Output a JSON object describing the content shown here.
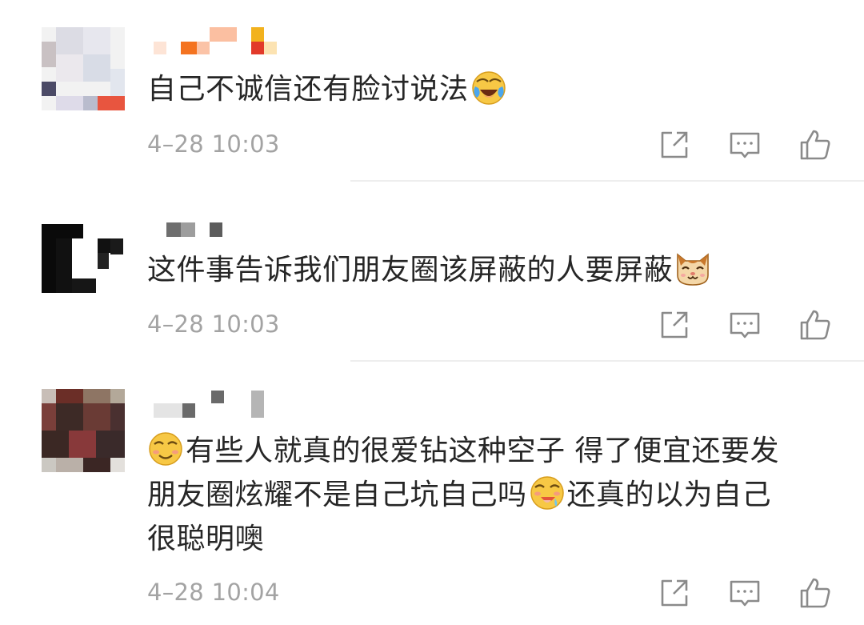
{
  "comments": [
    {
      "text": "自己不诚信还有脸讨说法",
      "emoji": "crying-laughing-emoji",
      "time": "4–28 10:03"
    },
    {
      "text": "这件事告诉我们朋友圈该屏蔽的人要屏蔽",
      "emoji": "cat-face-emoji",
      "time": "4–28 10:03"
    },
    {
      "text_prefix_emoji": "smirk-emoji",
      "text_line1": "有些人就真的很爱钻这种空子 得了便宜还要发",
      "text_line2_a": "朋友圈炫耀不是自己坑自己吗",
      "emoji_mid": "drooling-emoji",
      "text_line2_b": "还真的以为自己",
      "text_line3": "很聪明噢",
      "time": "4–28 10:04"
    }
  ],
  "icons": {
    "share": "share-icon",
    "reply": "comment-icon",
    "like": "thumbs-up-icon"
  },
  "colors": {
    "text": "#262626",
    "timestamp": "#a3a3a3",
    "icon": "#8a8a8a",
    "divider": "#eeeeee"
  }
}
